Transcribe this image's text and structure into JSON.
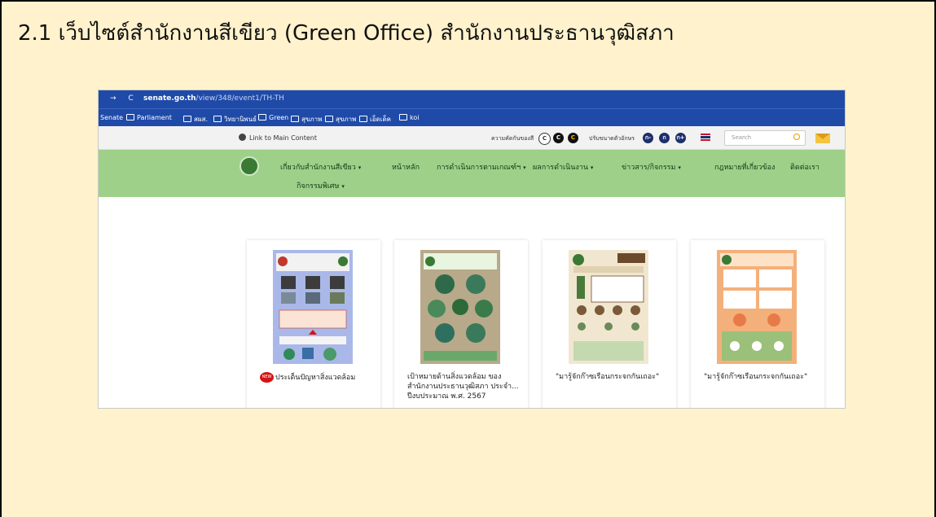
{
  "slide": {
    "title": "2.1  เว็บไซต์สำนักงานสีเขียว (Green Office) สำนักงานประธานวุฒิสภา"
  },
  "browser": {
    "nav_glyphs": "→ C",
    "url_host": "senate.go.th",
    "url_path": "/view/348/event1/TH-TH",
    "bookmarks": [
      "Senate",
      "Parliament",
      "สผส.",
      "วิทยานิพนธ์",
      "Green",
      "สุขภาพ",
      "สุขภาพ",
      "เอ็ดเด็ค",
      "koi"
    ]
  },
  "site": {
    "skip_link": "Link to Main Content",
    "contrast_label": "ความคัดกันของสี",
    "contrast_buttons": [
      "C",
      "C",
      "C"
    ],
    "font_size_label": "ปรับขนาดตัวอักษร",
    "font_size_buttons": [
      "ก-",
      "ก",
      "ก+"
    ],
    "search_placeholder": "Search",
    "nav": {
      "about": "เกี่ยวกับสำนักงานสีเขียว",
      "home": "หน้าหลัก",
      "criteria": "การดำเนินการตามเกณฑ์ฯ",
      "results": "ผลการดำเนินงาน",
      "news": "ข่าวสาร/กิจกรรม",
      "law": "กฎหมายที่เกี่ยวข้อง",
      "contact": "ติดต่อเรา",
      "special": "กิจกรรมพิเศษ"
    },
    "cards": [
      {
        "badge": "NEW",
        "caption": "ประเด็นปัญหาสิ่งแวดล้อม"
      },
      {
        "caption": "เป้าหมายด้านสิ่งแวดล้อม ของสำนักงานประธานวุฒิสภา ประจำ... ปีงบประมาณ พ.ศ. 2567"
      },
      {
        "caption": "\"มารู้จักก๊าซเรือนกระจกกันเถอะ\""
      },
      {
        "caption": "\"มารู้จักก๊าซเรือนกระจกกันเถอะ\""
      }
    ]
  },
  "colors": {
    "slide_bg": "#fff2cc",
    "browser_bar": "#1f4aa8",
    "nav_green": "#9fd08a"
  }
}
